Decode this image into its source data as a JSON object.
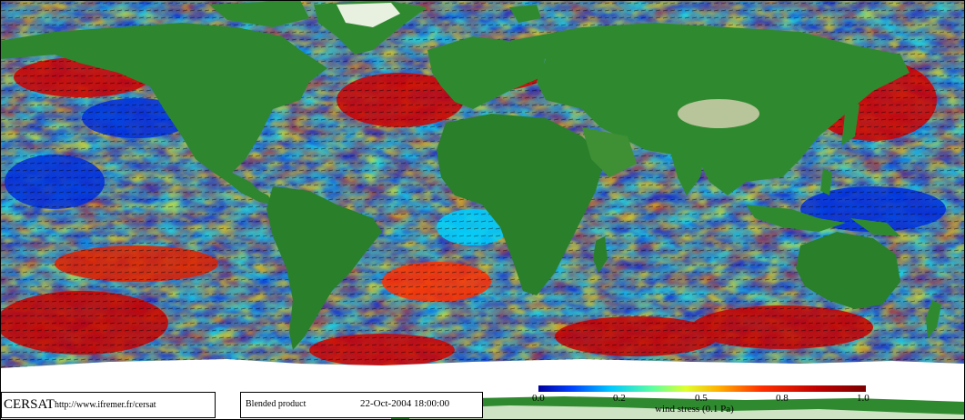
{
  "footer": {
    "brand": "CERSAT",
    "url": "http://www.ifremer.fr/cersat",
    "product": "Blended product",
    "datetime": "22-Oct-2004 18:00:00"
  },
  "colorbar": {
    "tick_labels": [
      "0.0",
      "0.2",
      "0.5",
      "0.8",
      "1.0"
    ],
    "label": "wind stress (0.1 Pa)",
    "colors": [
      "#0000c0",
      "#0050ff",
      "#00c8ff",
      "#40ffc0",
      "#c8ff40",
      "#ffe000",
      "#ff8000",
      "#e00000",
      "#a00000"
    ]
  },
  "legend_colors": {
    "land_low": "#1e6e1e",
    "land_mid": "#3f8f35",
    "land_high": "#b8c49a",
    "ice": "#ffffff"
  }
}
